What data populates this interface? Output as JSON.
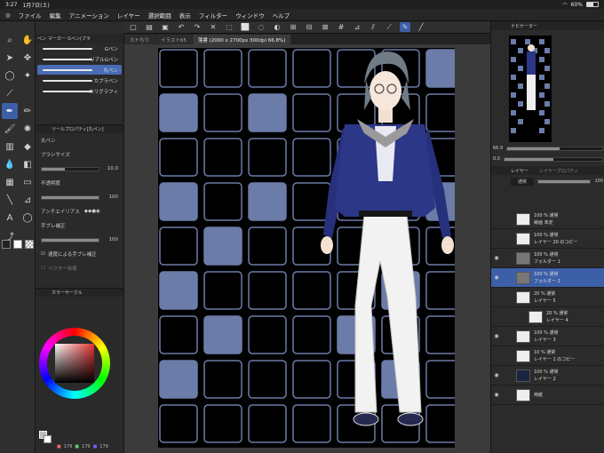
{
  "status": {
    "time": "3:27",
    "date": "1月7日(土)",
    "battery": "60%",
    "battery_level": 0.6
  },
  "menu": [
    "ファイル",
    "編集",
    "アニメーション",
    "レイヤー",
    "選択範囲",
    "表示",
    "フィルター",
    "ウィンドウ",
    "ヘルプ"
  ],
  "cmd_icons": [
    "undo-icon",
    "redo-icon",
    "select-icon",
    "snap-icon",
    "ruler-icon",
    "pen-mode-icon"
  ],
  "tabs": [
    "カトちり",
    "イラスト65",
    "落書 (2000 x 2700px 300dpi 66.8%)"
  ],
  "subtool": {
    "tabs": [
      "ペン",
      "マーカー",
      "Gペン(ブラ"
    ],
    "brushes": [
      "Gペン",
      "リアルGペン",
      "丸ペン",
      "カブラペン",
      "カリグラフィ"
    ]
  },
  "props": {
    "title": "ツールプロパティ[丸ペン]",
    "brush_name": "丸ペン",
    "size_label": "ブラシサイズ",
    "size_value": "10.0",
    "opacity_label": "不透明度",
    "opacity_value": "100",
    "aa_label": "アンチエイリアス",
    "stab_label": "手ブレ補正",
    "stab_value": "100",
    "speed_label": "速度による手ブレ補正",
    "vector_label": "ベクター吸着"
  },
  "color": {
    "title": "カラーサークル",
    "r": "179",
    "g": "179",
    "b": "179"
  },
  "nav": {
    "title": "ナビゲーター",
    "zoom": "66.9",
    "angle": "0.0"
  },
  "layers": {
    "tabs": [
      "レイヤー",
      "レイヤープロパティ"
    ],
    "blend": "通常",
    "opacity": "100",
    "items": [
      {
        "line1": "100 % 通常",
        "line2": "線画 未定",
        "thumb": "light"
      },
      {
        "line1": "100 % 通常",
        "line2": "レイヤー 20 のコピー",
        "thumb": "light"
      },
      {
        "line1": "100 % 通常",
        "line2": "フォルダー 1",
        "thumb": "folder"
      },
      {
        "line1": "100 % 通常",
        "line2": "フォルダー 2",
        "thumb": "folder"
      },
      {
        "line1": "20 % 通常",
        "line2": "レイヤー 5",
        "thumb": "light"
      },
      {
        "line1": "20 % 通常",
        "line2": "レイヤー 4",
        "thumb": "light"
      },
      {
        "line1": "100 % 通常",
        "line2": "レイヤー 3",
        "thumb": "light"
      },
      {
        "line1": "10 % 通常",
        "line2": "レイヤー 1 のコピー",
        "thumb": "light"
      },
      {
        "line1": "100 % 通常",
        "line2": "レイヤー 2",
        "thumb": "dark"
      },
      {
        "line1": "",
        "line2": "用紙",
        "thumb": "light"
      }
    ]
  },
  "colors": {
    "accent": "#3c5fa8",
    "tile_blue": "#6c7ca8",
    "tile_black": "#000000"
  }
}
